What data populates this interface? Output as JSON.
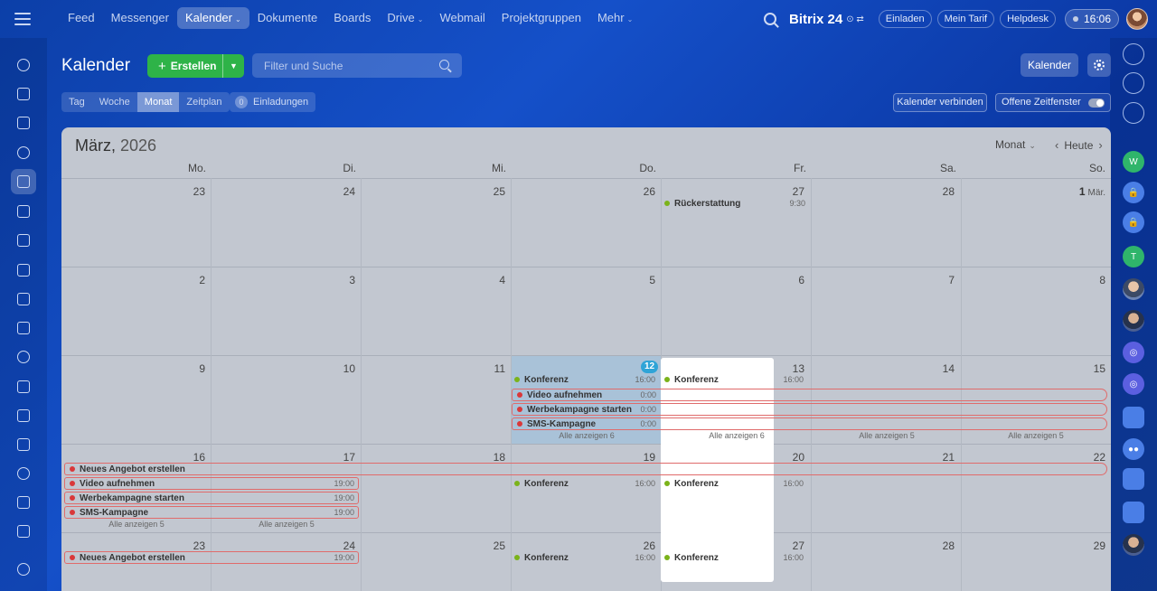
{
  "topbar": {
    "nav": [
      {
        "label": "Feed",
        "active": false,
        "dropdown": false
      },
      {
        "label": "Messenger",
        "active": false,
        "dropdown": false
      },
      {
        "label": "Kalender",
        "active": true,
        "dropdown": true
      },
      {
        "label": "Dokumente",
        "active": false,
        "dropdown": false
      },
      {
        "label": "Boards",
        "active": false,
        "dropdown": false
      },
      {
        "label": "Drive",
        "active": false,
        "dropdown": true
      },
      {
        "label": "Webmail",
        "active": false,
        "dropdown": false
      },
      {
        "label": "Projektgruppen",
        "active": false,
        "dropdown": false
      },
      {
        "label": "Mehr",
        "active": false,
        "dropdown": true
      }
    ],
    "brand": "Bitrix 24",
    "brand_suffix": "⊙ ⇄",
    "invite_label": "Einladen",
    "tariff_label": "Mein Tarif",
    "helpdesk_label": "Helpdesk",
    "clock": "16:06"
  },
  "header": {
    "title": "Kalender",
    "create_label": "Erstellen",
    "search_placeholder": "Filter und Suche",
    "calendar_button": "Kalender",
    "views": [
      "Tag",
      "Woche",
      "Monat",
      "Zeitplan"
    ],
    "active_view": "Monat",
    "invites_count": "0",
    "invites_label": "Einladungen",
    "connect_label": "Kalender verbinden",
    "open_slots_label": "Offene Zeitfenster"
  },
  "calendar": {
    "month": "März,",
    "year": "2026",
    "mode_label": "Monat",
    "today_label": "Heute",
    "weekdays": [
      "Mo.",
      "Di.",
      "Mi.",
      "Do.",
      "Fr.",
      "Sa.",
      "So."
    ],
    "weeks": [
      [
        "23",
        "24",
        "25",
        "26",
        "27",
        "28",
        "1"
      ],
      [
        "2",
        "3",
        "4",
        "5",
        "6",
        "7",
        "8"
      ],
      [
        "9",
        "10",
        "11",
        "12",
        "13",
        "14",
        "15"
      ],
      [
        "16",
        "17",
        "18",
        "19",
        "20",
        "21",
        "22"
      ],
      [
        "23",
        "24",
        "25",
        "26",
        "27",
        "28",
        "29"
      ]
    ],
    "first_month_suffix": "Mär.",
    "events": {
      "rueck": {
        "title": "Rückerstattung",
        "time": "9:30"
      },
      "konf_w3_do": {
        "title": "Konferenz",
        "time": "16:00"
      },
      "konf_w3_fr": {
        "title": "Konferenz",
        "time": "16:00"
      },
      "video_w3": {
        "title": "Video aufnehmen",
        "time": "0:00"
      },
      "werbe_w3": {
        "title": "Werbekampagne starten",
        "time": "0:00"
      },
      "sms_w3": {
        "title": "SMS-Kampagne",
        "time": "0:00"
      },
      "more_do": "Alle anzeigen 6",
      "more_fr": "Alle anzeigen 6",
      "more_sa": "Alle anzeigen 5",
      "more_so": "Alle anzeigen 5",
      "angebot_w4": {
        "title": "Neues Angebot erstellen"
      },
      "video_w4": {
        "title": "Video aufnehmen",
        "time": "19:00"
      },
      "werbe_w4": {
        "title": "Werbekampagne starten",
        "time": "19:00"
      },
      "sms_w4": {
        "title": "SMS-Kampagne",
        "time": "19:00"
      },
      "more_mo4": "Alle anzeigen 5",
      "more_di4": "Alle anzeigen 5",
      "konf_w4_do": {
        "title": "Konferenz",
        "time": "16:00"
      },
      "konf_w4_fr": {
        "title": "Konferenz",
        "time": "16:00"
      },
      "angebot_w5": {
        "title": "Neues Angebot erstellen",
        "time": "19:00"
      },
      "konf_w5_do": {
        "title": "Konferenz",
        "time": "16:00"
      },
      "konf_w5_fr": {
        "title": "Konferenz",
        "time": "16:00"
      }
    }
  },
  "colors": {
    "event_green": "#7bb31a",
    "event_red": "#d9383a",
    "today": "#2fa4d7",
    "create": "#2eb348"
  }
}
